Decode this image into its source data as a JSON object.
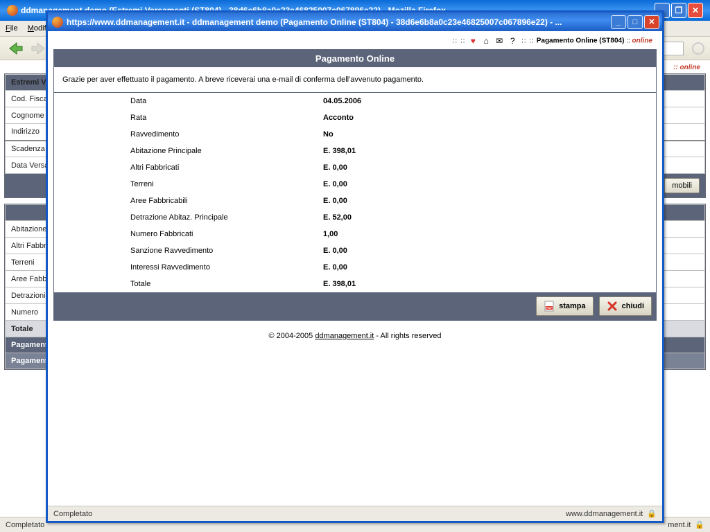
{
  "bg": {
    "title": "ddmanagement demo (Estremi Versamenti (ST804) - 38d6e6b8a0c23e46825007c067896e22) - Mozilla Firefox",
    "menu": [
      "File",
      "Modifica"
    ],
    "breadcrumb_label": ":: online",
    "sidebar": {
      "header": "Estremi Versamenti",
      "rows": [
        "Cod. Fiscale",
        "Cognome",
        "Indirizzo",
        "Scadenza",
        "Data Versamento"
      ]
    },
    "button_mobili": "mobili",
    "section2_head": "",
    "section2_rows": [
      "Abitazione",
      "Altri Fabbricati",
      "Terreni",
      "Aree Fabbricabili",
      "Detrazioni",
      "Numero"
    ],
    "totale": "Totale",
    "pagamento1": "Pagamento",
    "pagamento2": "Pagamento",
    "status_left": "Completato",
    "status_right": "ment.it"
  },
  "popup": {
    "title": "https://www.ddmanagement.it - ddmanagement demo (Pagamento Online (ST804) - 38d6e6b8a0c23e46825007c067896e22) - ...",
    "breadcrumb_pre": ":: ::",
    "breadcrumb_label": "Pagamento Online (ST804)",
    "breadcrumb_suf": ":: online",
    "panel_title": "Pagamento Online",
    "panel_msg": "Grazie per aver effettuato il pagamento. A breve riceverai una e-mail di conferma dell'avvenuto pagamento.",
    "rows": [
      {
        "k": "Data",
        "v": "04.05.2006"
      },
      {
        "k": "Rata",
        "v": "Acconto"
      },
      {
        "k": "Ravvedimento",
        "v": "No"
      },
      {
        "k": "Abitazione Principale",
        "v": "E. 398,01"
      },
      {
        "k": "Altri Fabbricati",
        "v": "E. 0,00"
      },
      {
        "k": "Terreni",
        "v": "E. 0,00"
      },
      {
        "k": "Aree Fabbricabili",
        "v": "E. 0,00"
      },
      {
        "k": "Detrazione Abitaz. Principale",
        "v": "E. 52,00"
      },
      {
        "k": "Numero Fabbricati",
        "v": "1,00"
      },
      {
        "k": "Sanzione Ravvedimento",
        "v": "E. 0,00"
      },
      {
        "k": "Interessi Ravvedimento",
        "v": "E. 0,00"
      },
      {
        "k": "Totale",
        "v": "E. 398,01"
      }
    ],
    "btn_stampa": "stampa",
    "btn_chiudi": "chiudi",
    "footer_pre": "© 2004-2005 ",
    "footer_link": "ddmanagement.it",
    "footer_suf": " - All rights reserved",
    "status_left": "Completato",
    "status_right": "www.ddmanagement.it"
  }
}
